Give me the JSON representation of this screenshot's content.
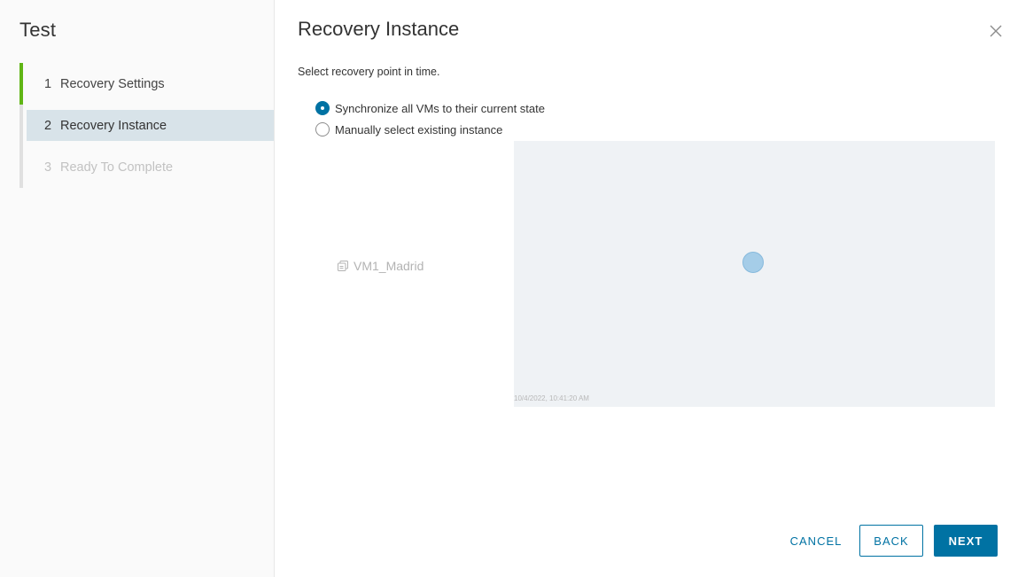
{
  "wizard": {
    "title": "Test",
    "steps": [
      {
        "num": "1",
        "label": "Recovery Settings",
        "state": "done"
      },
      {
        "num": "2",
        "label": "Recovery Instance",
        "state": "active"
      },
      {
        "num": "3",
        "label": "Ready To Complete",
        "state": "disabled"
      }
    ]
  },
  "main": {
    "title": "Recovery Instance",
    "subtitle": "Select recovery point in time.",
    "options": [
      {
        "label": "Synchronize all VMs to their current state",
        "checked": true
      },
      {
        "label": "Manually select existing instance",
        "checked": false
      }
    ],
    "vm_name": "VM1_Madrid",
    "vm_icon": "vm-icon",
    "timeline_tick": "10/4/2022, 10:41:20 AM"
  },
  "footer": {
    "cancel_label": "CANCEL",
    "back_label": "BACK",
    "next_label": "NEXT"
  },
  "colors": {
    "accent": "#0072a3",
    "done_step": "#60b515",
    "active_step_bg": "#d8e3e9",
    "timeline_bg": "#eff2f5",
    "recovery_point": "#a5cde8"
  }
}
